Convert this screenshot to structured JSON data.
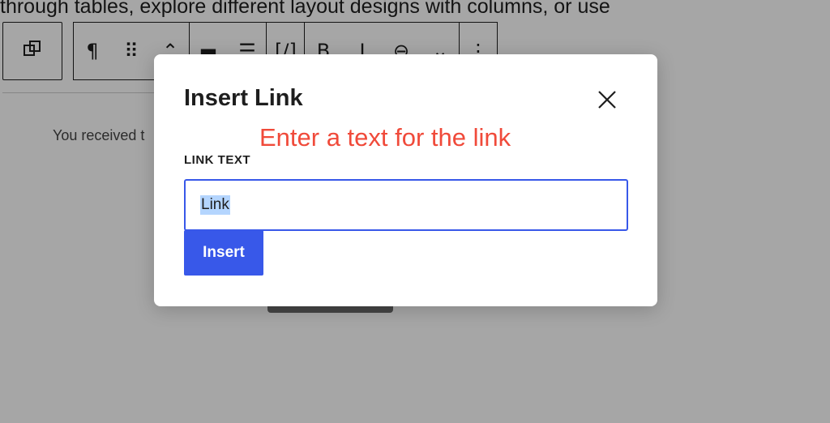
{
  "background": {
    "top_text": "through tables, explore different layout designs with columns, or use",
    "toolbar": {
      "transform_icon": "block-transform-icon",
      "icons": [
        "¶",
        "⠿",
        "⌃",
        "▬",
        "☰",
        "[/]",
        "B",
        "I",
        "⊖",
        "⌄",
        "⋮"
      ],
      "icon_names": [
        "paragraph-icon",
        "drag-handle-icon",
        "move-up-icon",
        "align-icon",
        "justify-icon",
        "shortcode-icon",
        "bold-icon",
        "italic-icon",
        "link-icon",
        "more-icon",
        "options-icon"
      ]
    },
    "paragraph_text": "You received t"
  },
  "modal": {
    "title": "Insert Link",
    "annotation": "Enter a text for the link",
    "field_label": "LINK TEXT",
    "input_value": "Link",
    "insert_label": "Insert",
    "close_icon": "close-icon"
  },
  "colors": {
    "primary": "#3858e9",
    "annotation": "#f04a3a",
    "selection": "#b4d5fe"
  }
}
